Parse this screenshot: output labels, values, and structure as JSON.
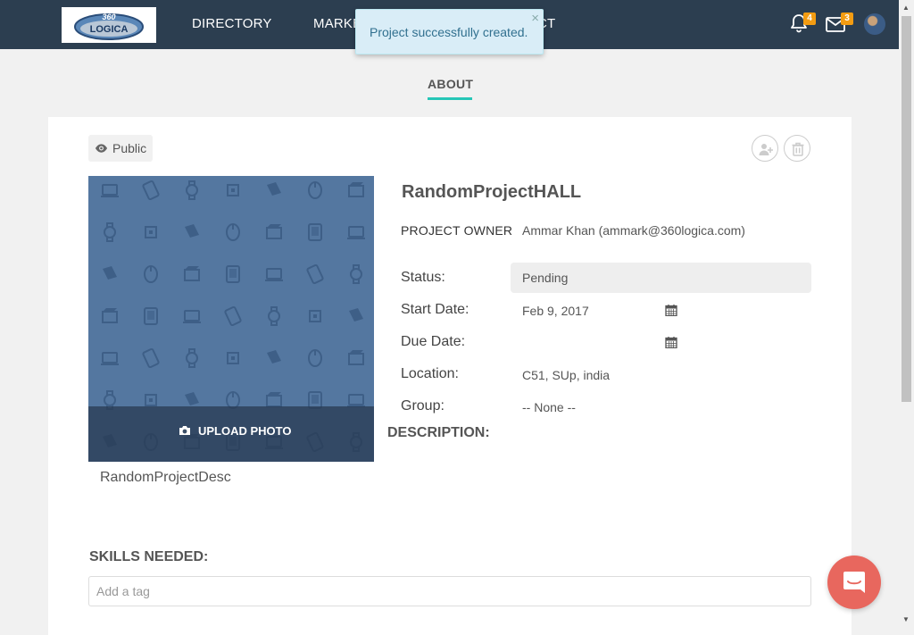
{
  "nav": {
    "logo_text": "360 LOGICA",
    "items": [
      {
        "label": "DIRECTORY"
      },
      {
        "label": "MARKE"
      },
      {
        "label": "CT"
      }
    ],
    "notifications_count": "4",
    "messages_count": "3"
  },
  "toast": {
    "message": "Project successfully created.",
    "close": "×"
  },
  "tabs": {
    "about": "ABOUT"
  },
  "project": {
    "visibility": "Public",
    "title": "RandomProjectHALL",
    "owner_label": "PROJECT OWNER",
    "owner_value": "Ammar Khan (ammark@360logica.com)",
    "upload_label": "UPLOAD PHOTO",
    "description_text": "RandomProjectDesc",
    "fields": {
      "status": {
        "label": "Status:",
        "value": "Pending"
      },
      "start_date": {
        "label": "Start Date:",
        "value": "Feb 9, 2017"
      },
      "due_date": {
        "label": "Due Date:",
        "value": ""
      },
      "location": {
        "label": "Location:",
        "value": "C51, SUp, india"
      },
      "group": {
        "label": "Group:",
        "value": "-- None --"
      }
    },
    "description_label": "DESCRIPTION:",
    "skills_label": "SKILLS NEEDED:",
    "tag_placeholder": "Add a tag"
  },
  "colors": {
    "topbar": "#2c3e50",
    "accent": "#26c6b7",
    "badge": "#f39c12",
    "chat": "#e8675e",
    "photo_bg": "#5477a0"
  }
}
